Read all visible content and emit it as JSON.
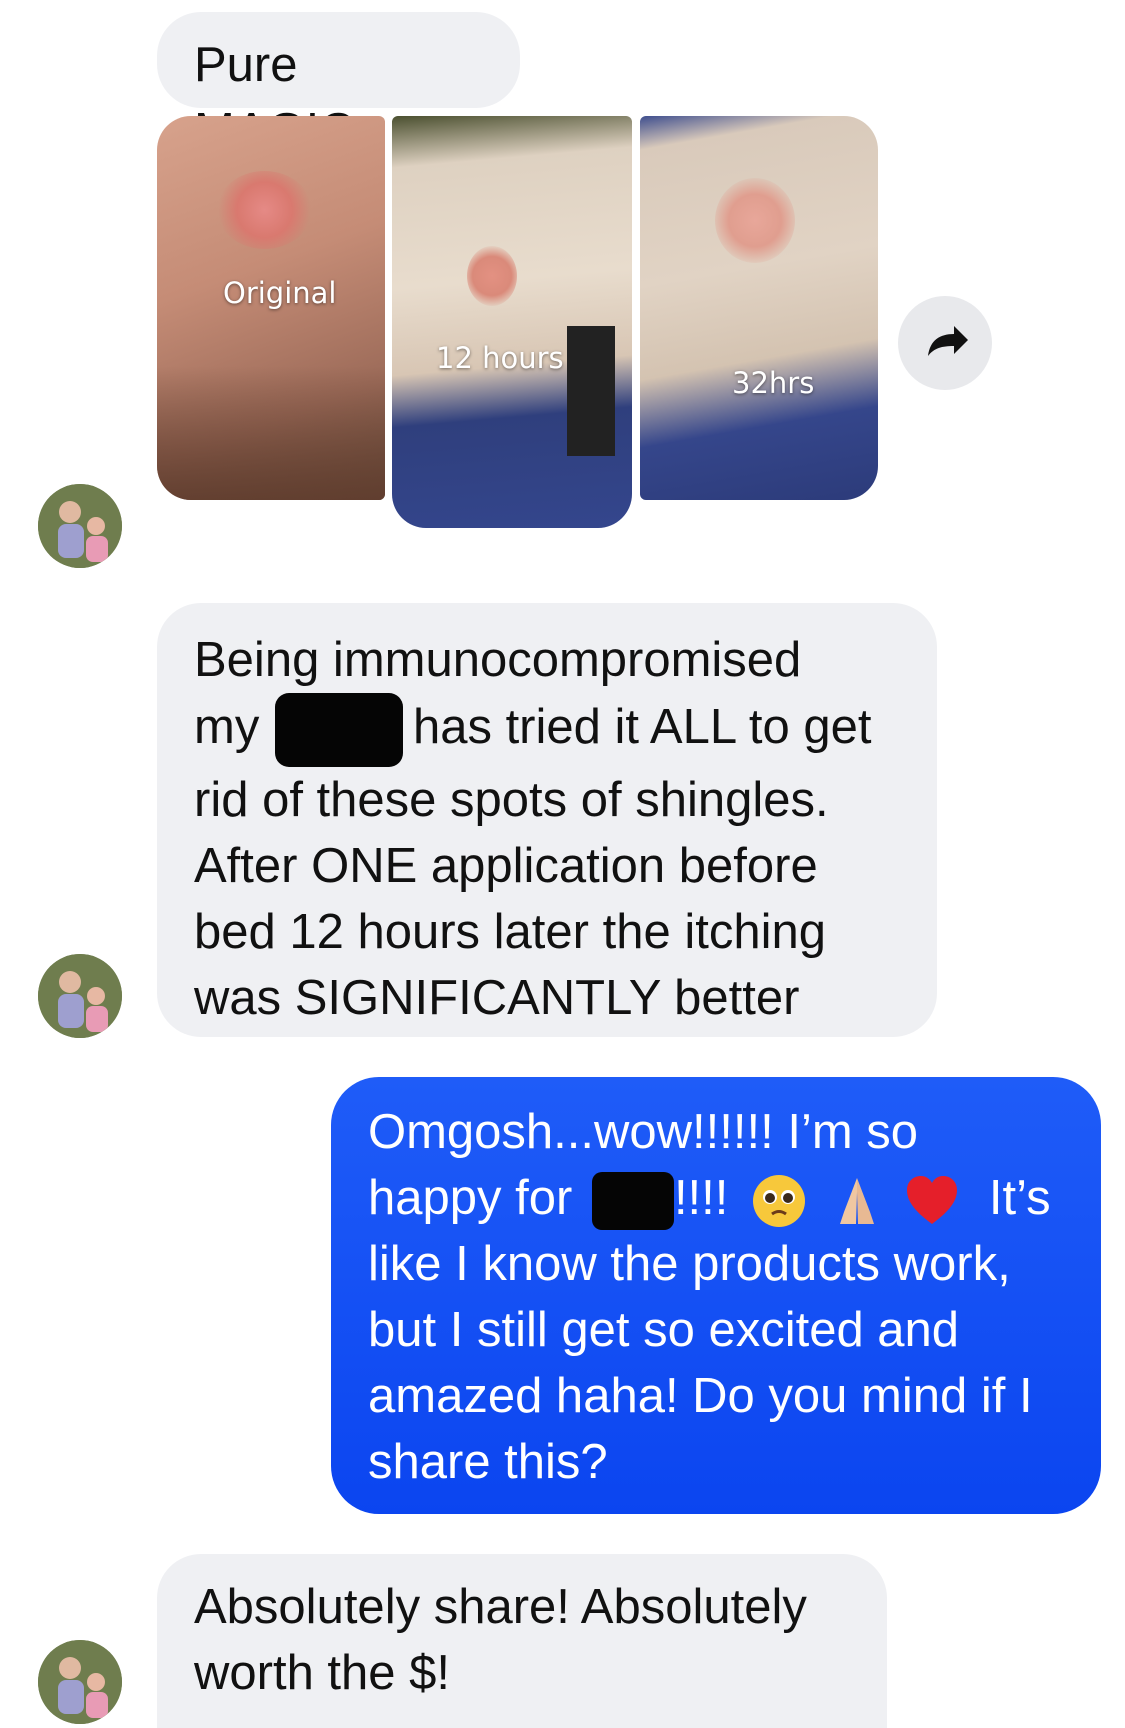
{
  "messages": {
    "m1": {
      "text": "Pure MAGIC."
    },
    "photos": {
      "labels": [
        "Original",
        "12 hours",
        "32hrs"
      ]
    },
    "m2": {
      "line1": "Being immunocompromised",
      "line2_start": "my",
      "line2_end": "has tried it ALL to get",
      "line3": "rid of these spots of shingles.",
      "line4": "After ONE application before",
      "line5": "bed 12 hours later the itching",
      "line6": "was SIGNIFICANTLY better"
    },
    "m3": {
      "line1": "Omgosh...wow!!!!!! I’m so",
      "line2_start": "happy for",
      "line2_mid": "!!!!",
      "line2_end": "It’s",
      "line3": "like I know the products work,",
      "line4": "but I still get so excited and",
      "line5": "amazed haha! Do you mind if I",
      "line6": "share this?"
    },
    "m4": {
      "line1": "Absolutely share! Absolutely",
      "line2": "worth the $!"
    }
  },
  "colors": {
    "incoming_bubble": "#eff0f3",
    "outgoing_bubble": "#1450f5",
    "text_dark": "#111111",
    "text_light": "#ffffff"
  },
  "icons": {
    "share": "share-arrow-icon",
    "emoji1": "pleading-face-emoji",
    "emoji2": "folded-hands-emoji",
    "emoji3": "red-heart-emoji"
  }
}
